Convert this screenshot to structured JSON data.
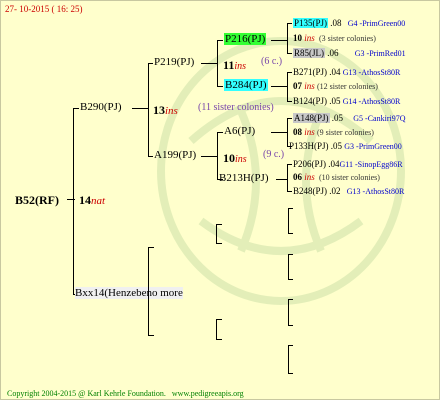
{
  "header": {
    "date": "27- 10-2015 ( 16: 25)"
  },
  "footer": {
    "copyright": "Copyright 2004-2015 @ Karl Kehrle Foundation.",
    "site": "www.pedigreeapis.org"
  },
  "root": {
    "name": "B52(RF)",
    "gen": "14",
    "gen_suffix": "nat"
  },
  "sire": {
    "name": "B290(PJ)",
    "gen": "13",
    "gen_suffix": "ins",
    "sisters": "(11 sister colonies)"
  },
  "dam": {
    "name": "Bxx14(Henzebeno more"
  },
  "ss": {
    "name": "P219(PJ)",
    "gen": "11",
    "gen_suffix": "ins",
    "sisters": "(6 c.)"
  },
  "sd": {
    "name": "A199(PJ)",
    "gen": "10",
    "gen_suffix": "ins",
    "sisters": "(9 c.)"
  },
  "sss": {
    "name": "P216(PJ)"
  },
  "ssd": {
    "name": "B284(PJ)"
  },
  "sds": {
    "name": "A6(PJ)",
    "gen": "10",
    "gen_suffix": "ins",
    "sisters": "(9 c.)"
  },
  "sdd": {
    "name": "B213H(PJ)"
  },
  "g5": [
    {
      "name": "P135(PJ)",
      "val": ".08",
      "breeder": "G4 -PrimGreen00"
    },
    {
      "gen": "10",
      "gen_suffix": "ins",
      "note": "(3 sister colonies)"
    },
    {
      "name": "R85(JL)",
      "val": ".06",
      "breeder": "G3 -PrimRed01"
    },
    {
      "name": "B271(PJ)",
      "val": ".04",
      "breeder": "G13 -AthosSt80R"
    },
    {
      "gen": "07",
      "gen_suffix": "ins",
      "note": "(12 sister colonies)"
    },
    {
      "name": "B124(PJ)",
      "val": ".05",
      "breeder": "G14 -AthosSt80R"
    },
    {
      "name": "A148(PJ)",
      "val": ".05",
      "breeder": "G5 -Cankiri97Q"
    },
    {
      "gen": "08",
      "gen_suffix": "ins",
      "note": "(9 sister colonies)"
    },
    {
      "name": "P133H(PJ)",
      "val": ".05",
      "breeder": "G3 -PrimGreen00"
    },
    {
      "name": "P206(PJ)",
      "val": ".04",
      "breeder": "G11 -SinopEgg86R"
    },
    {
      "gen": "06",
      "gen_suffix": "ins",
      "note": "(10 sister colonies)"
    },
    {
      "name": "B248(PJ)",
      "val": ".02",
      "breeder": "G13 -AthosSt80R"
    }
  ],
  "colors": {
    "background": "#ffffcc",
    "cyan": "#33ffff",
    "green": "#33ff33",
    "grey": "#c8c8c8",
    "red": "#cc0000",
    "blue": "#0000cc"
  }
}
